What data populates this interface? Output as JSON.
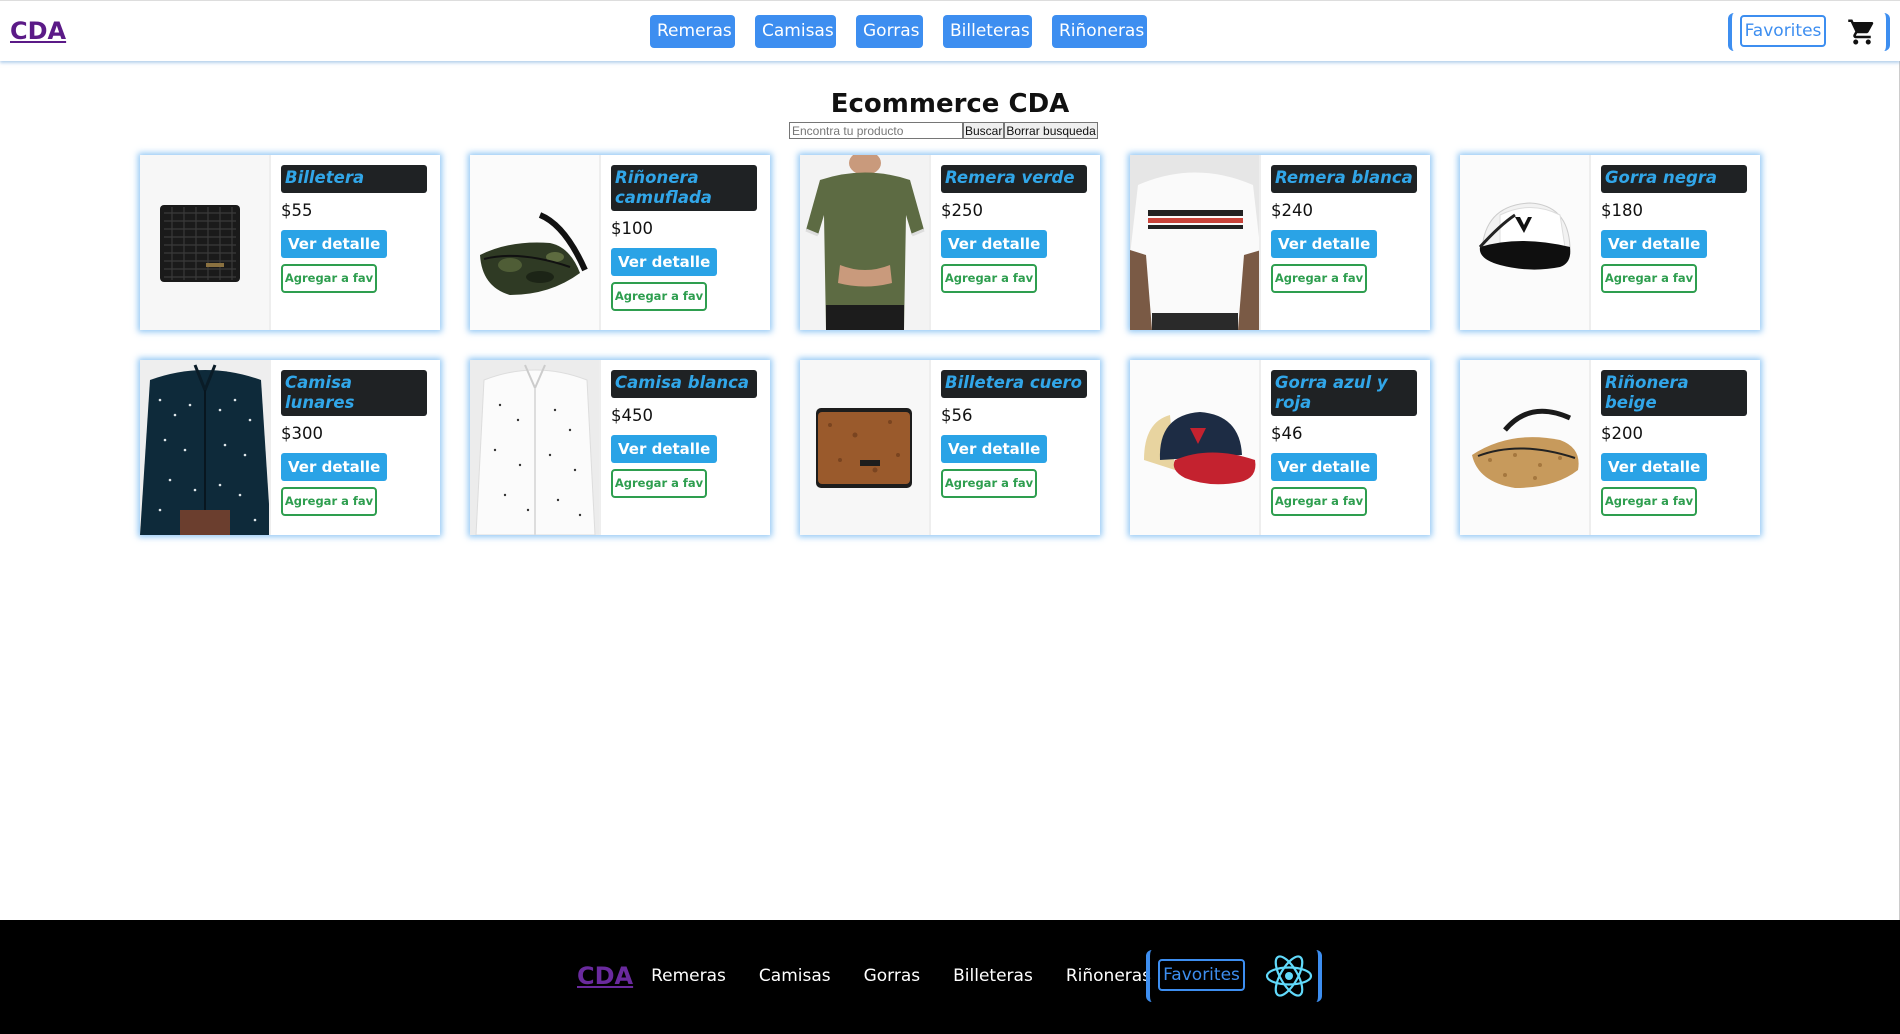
{
  "header": {
    "logo": "CDA",
    "nav": [
      "Remeras",
      "Camisas",
      "Gorras",
      "Billeteras",
      "Riñoneras"
    ],
    "favorites": "Favorites",
    "cart_icon": "cart-icon"
  },
  "main": {
    "title": "Ecommerce CDA",
    "search": {
      "placeholder": "Encontra tu producto",
      "value": "",
      "search_label": "Buscar",
      "clear_label": "Borrar busqueda"
    },
    "products": [
      {
        "name": "Billetera",
        "price": "$55",
        "image": "black-wallet-image"
      },
      {
        "name": "Riñonera camuflada",
        "price": "$100",
        "image": "camo-belt-bag-image"
      },
      {
        "name": "Remera verde",
        "price": "$250",
        "image": "green-tshirt-image"
      },
      {
        "name": "Remera blanca",
        "price": "$240",
        "image": "white-tshirt-image"
      },
      {
        "name": "Gorra negra",
        "price": "$180",
        "image": "black-cap-image"
      },
      {
        "name": "Camisa lunares",
        "price": "$300",
        "image": "dotted-navy-shirt-image"
      },
      {
        "name": "Camisa blanca",
        "price": "$450",
        "image": "white-shirt-image"
      },
      {
        "name": "Billetera cuero",
        "price": "$56",
        "image": "cork-wallet-image"
      },
      {
        "name": "Gorra azul y roja",
        "price": "$46",
        "image": "blue-red-cap-image"
      },
      {
        "name": "Riñonera beige",
        "price": "$200",
        "image": "beige-belt-bag-image"
      }
    ],
    "detail_label": "Ver detalle",
    "fav_label": "Agregar a fav"
  },
  "footer": {
    "logo": "CDA",
    "nav": [
      "Remeras",
      "Camisas",
      "Gorras",
      "Billeteras",
      "Riñoneras"
    ],
    "favorites": "Favorites",
    "react_icon": "react-icon"
  },
  "colors": {
    "nav_blue": "#3d8ef0",
    "detail_blue": "#2aa3e6",
    "title_bg": "#1f2224",
    "title_text": "#31a6e8",
    "fav_green": "#2e9e4f",
    "logo_purple": "#5b1a87",
    "footer_bg": "#000000"
  }
}
